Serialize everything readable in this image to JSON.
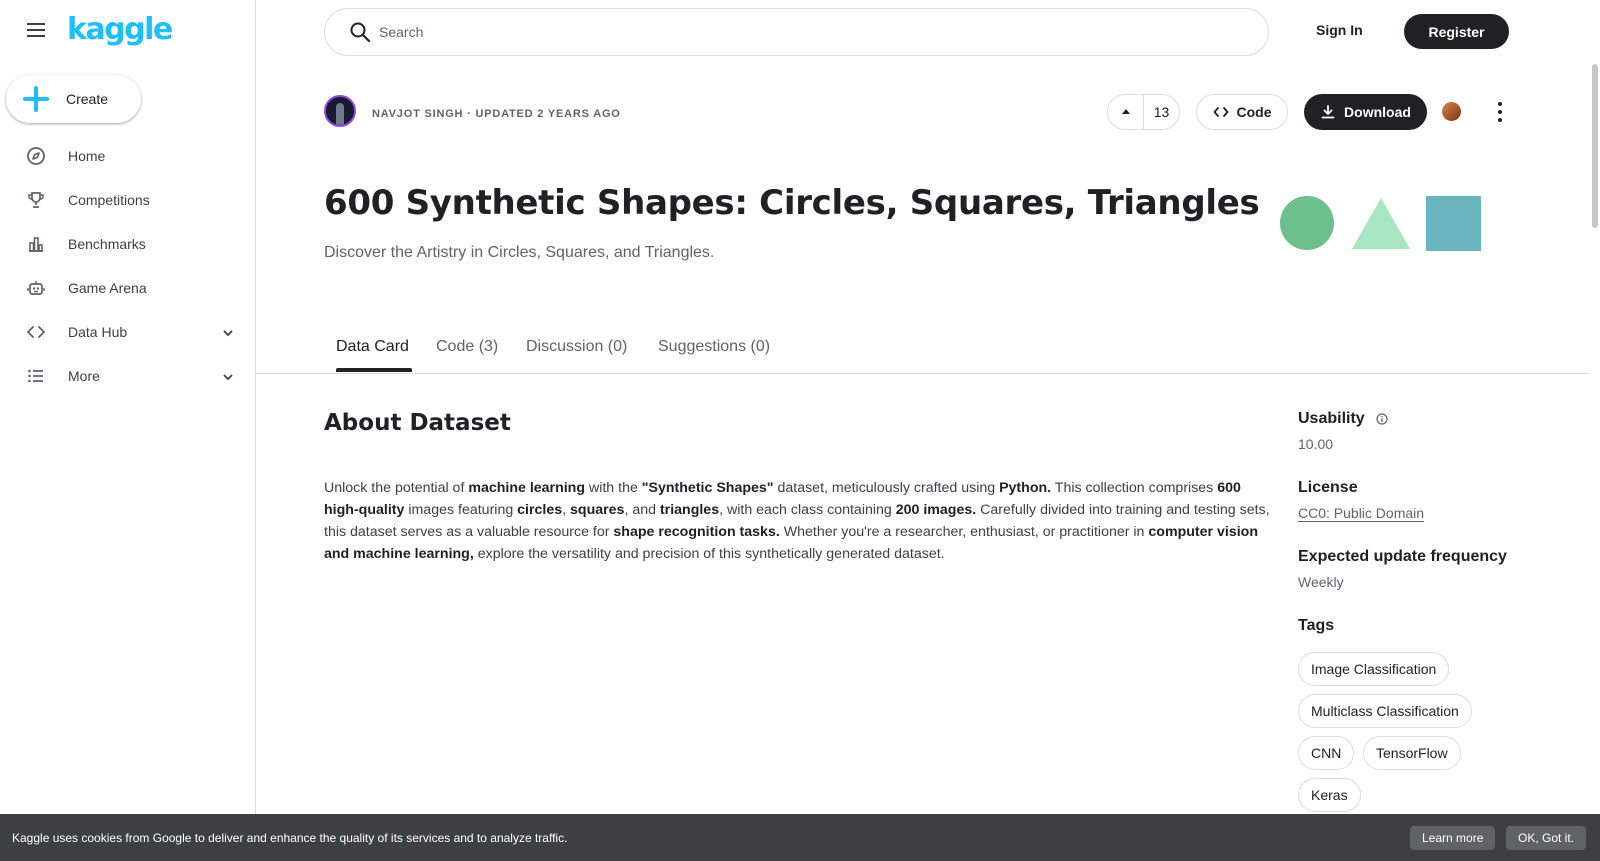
{
  "brand": {
    "logo": "kaggle",
    "accent": "#20beff"
  },
  "sidebar": {
    "create_label": "Create",
    "items": [
      {
        "label": "Home",
        "icon": "compass-icon"
      },
      {
        "label": "Competitions",
        "icon": "trophy-icon"
      },
      {
        "label": "Benchmarks",
        "icon": "bar-chart-icon"
      },
      {
        "label": "Game Arena",
        "icon": "robot-icon"
      },
      {
        "label": "Data Hub",
        "icon": "code-brackets-icon",
        "expandable": true
      },
      {
        "label": "More",
        "icon": "list-icon",
        "expandable": true
      }
    ]
  },
  "header": {
    "search_placeholder": "Search",
    "sign_in": "Sign In",
    "register": "Register"
  },
  "dataset": {
    "byline": "NAVJOT SINGH · UPDATED 2 YEARS AGO",
    "upvotes": "13",
    "code_label": "Code",
    "download_label": "Download",
    "title": "600 Synthetic Shapes: Circles, Squares, Triangles",
    "subtitle": "Discover the Artistry in Circles, Squares, and Triangles.",
    "shape_colors": {
      "circle": "#6cc08b",
      "triangle": "#a8e6c1",
      "square": "#6bb5c0"
    }
  },
  "tabs": [
    {
      "label": "Data Card",
      "active": true
    },
    {
      "label": "Code (3)",
      "active": false
    },
    {
      "label": "Discussion (0)",
      "active": false
    },
    {
      "label": "Suggestions (0)",
      "active": false
    }
  ],
  "about": {
    "heading": "About Dataset",
    "segments": [
      {
        "text": "Unlock the potential of ",
        "bold": false
      },
      {
        "text": "machine learning",
        "bold": true
      },
      {
        "text": " with the ",
        "bold": false
      },
      {
        "text": "\"Synthetic Shapes\"",
        "bold": true
      },
      {
        "text": " dataset, meticulously crafted using ",
        "bold": false
      },
      {
        "text": "Python.",
        "bold": true
      },
      {
        "text": " This collection comprises ",
        "bold": false
      },
      {
        "text": "600 high-quality",
        "bold": true
      },
      {
        "text": " images featuring ",
        "bold": false
      },
      {
        "text": "circles",
        "bold": true
      },
      {
        "text": ", ",
        "bold": false
      },
      {
        "text": "squares",
        "bold": true
      },
      {
        "text": ", and ",
        "bold": false
      },
      {
        "text": "triangles",
        "bold": true
      },
      {
        "text": ", with each class containing ",
        "bold": false
      },
      {
        "text": "200 images.",
        "bold": true
      },
      {
        "text": " Carefully divided into training and testing sets, this dataset serves as a valuable resource for ",
        "bold": false
      },
      {
        "text": "shape recognition tasks.",
        "bold": true
      },
      {
        "text": " Whether you're a researcher, enthusiast, or practitioner in ",
        "bold": false
      },
      {
        "text": "computer vision and machine learning,",
        "bold": true
      },
      {
        "text": " explore the versatility and precision of this synthetically generated dataset.",
        "bold": false
      }
    ]
  },
  "meta": {
    "usability_label": "Usability",
    "usability_value": "10.00",
    "license_label": "License",
    "license_value": "CC0: Public Domain",
    "update_label": "Expected update frequency",
    "update_value": "Weekly",
    "tags_label": "Tags",
    "tags": [
      "Image Classification",
      "Multiclass Classification",
      "CNN",
      "TensorFlow",
      "Keras"
    ]
  },
  "cookie": {
    "text": "Kaggle uses cookies from Google to deliver and enhance the quality of its services and to analyze traffic.",
    "learn_more": "Learn more",
    "ok": "OK, Got it."
  }
}
